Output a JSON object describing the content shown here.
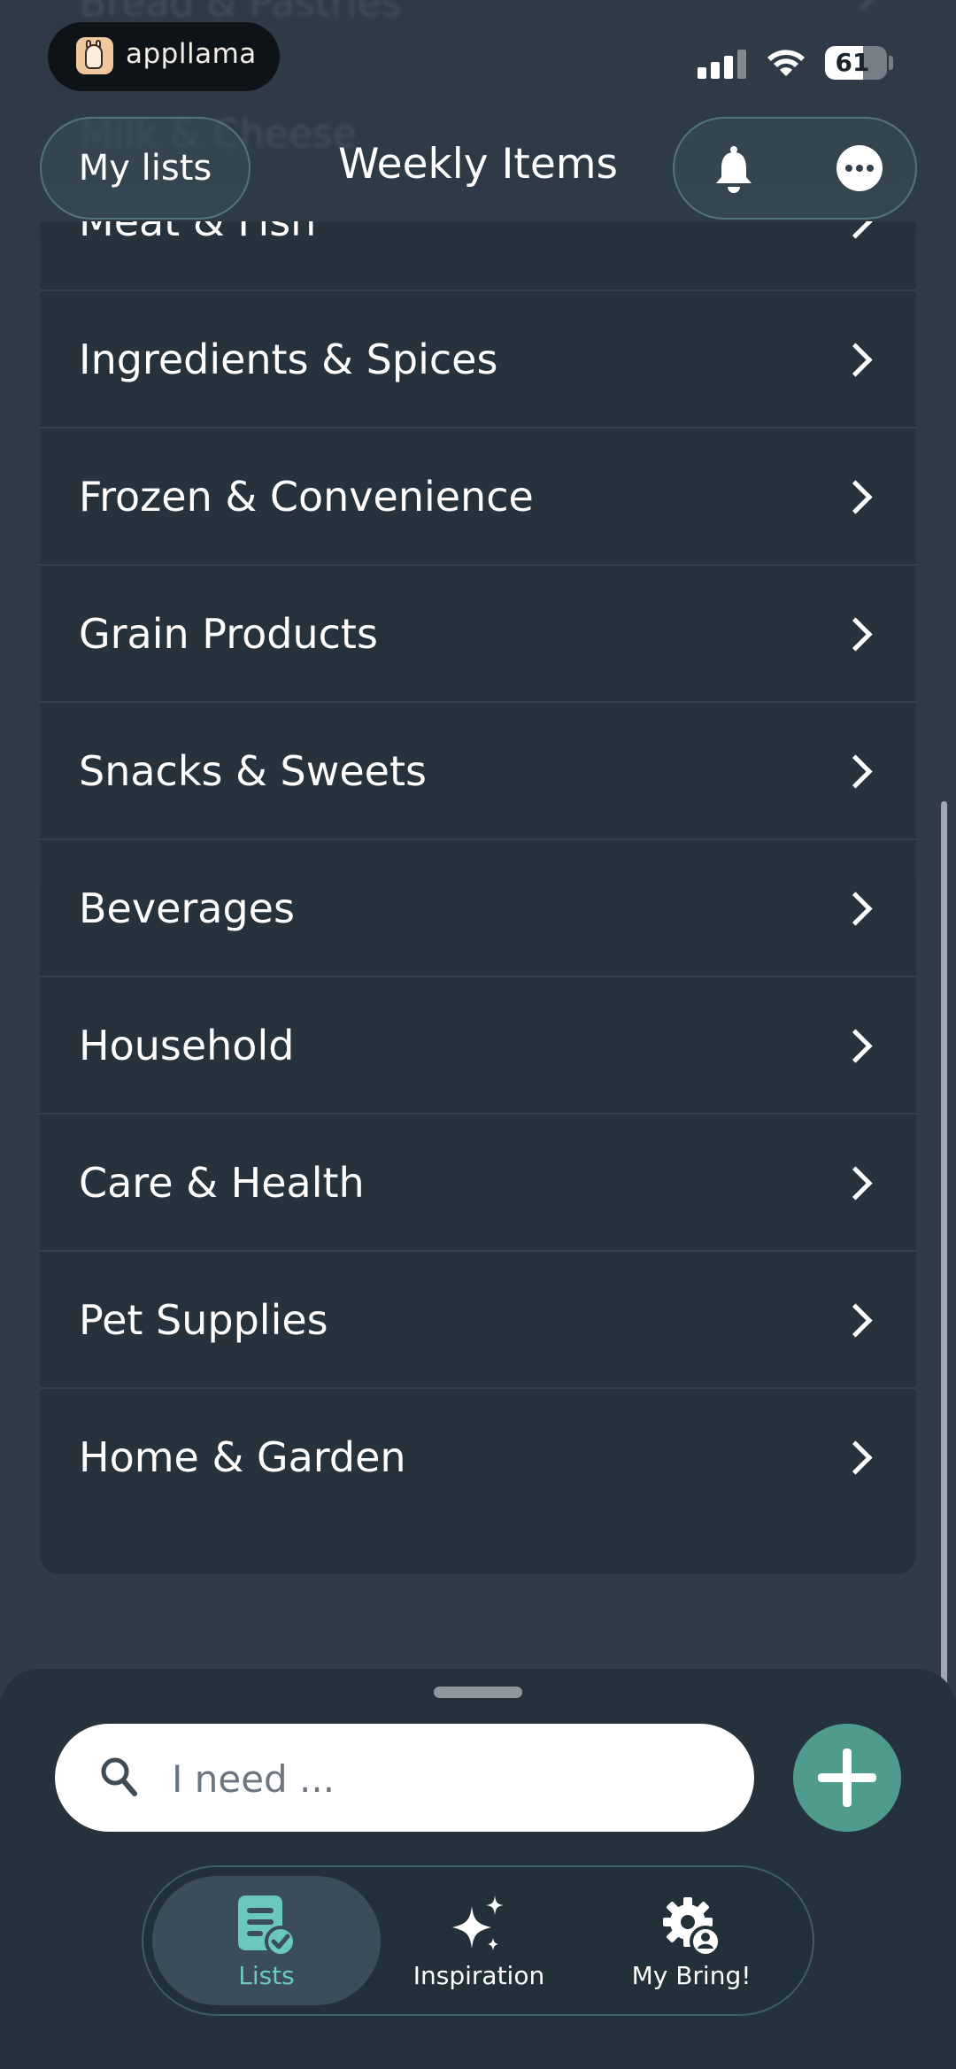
{
  "status_bar": {
    "brand": "appllama",
    "battery_level": "61",
    "battery_fraction": 0.61
  },
  "ghost": {
    "item_above_1": "Bread & Pastries",
    "item_above_2": "Milk & Cheese"
  },
  "header": {
    "back_label": "My lists",
    "title": "Weekly Items"
  },
  "categories": [
    {
      "label": "Meat & Fish"
    },
    {
      "label": "Ingredients & Spices"
    },
    {
      "label": "Frozen & Convenience"
    },
    {
      "label": "Grain Products"
    },
    {
      "label": "Snacks & Sweets"
    },
    {
      "label": "Beverages"
    },
    {
      "label": "Household"
    },
    {
      "label": "Care & Health"
    },
    {
      "label": "Pet Supplies"
    },
    {
      "label": "Home & Garden"
    }
  ],
  "search": {
    "placeholder": "I need ...",
    "value": ""
  },
  "tabs": {
    "lists": "Lists",
    "inspiration": "Inspiration",
    "my_bring": "My Bring!",
    "active": "lists"
  },
  "colors": {
    "accent": "#4f9b8e",
    "active_tab_text": "#6ac9ba",
    "background": "#2f3c47",
    "list_background": "#26323c"
  },
  "icons": {
    "notifications": "bell-icon",
    "more": "more-icon",
    "search": "search-icon",
    "add": "plus-icon",
    "row_disclosure": "chevron-right-icon"
  }
}
